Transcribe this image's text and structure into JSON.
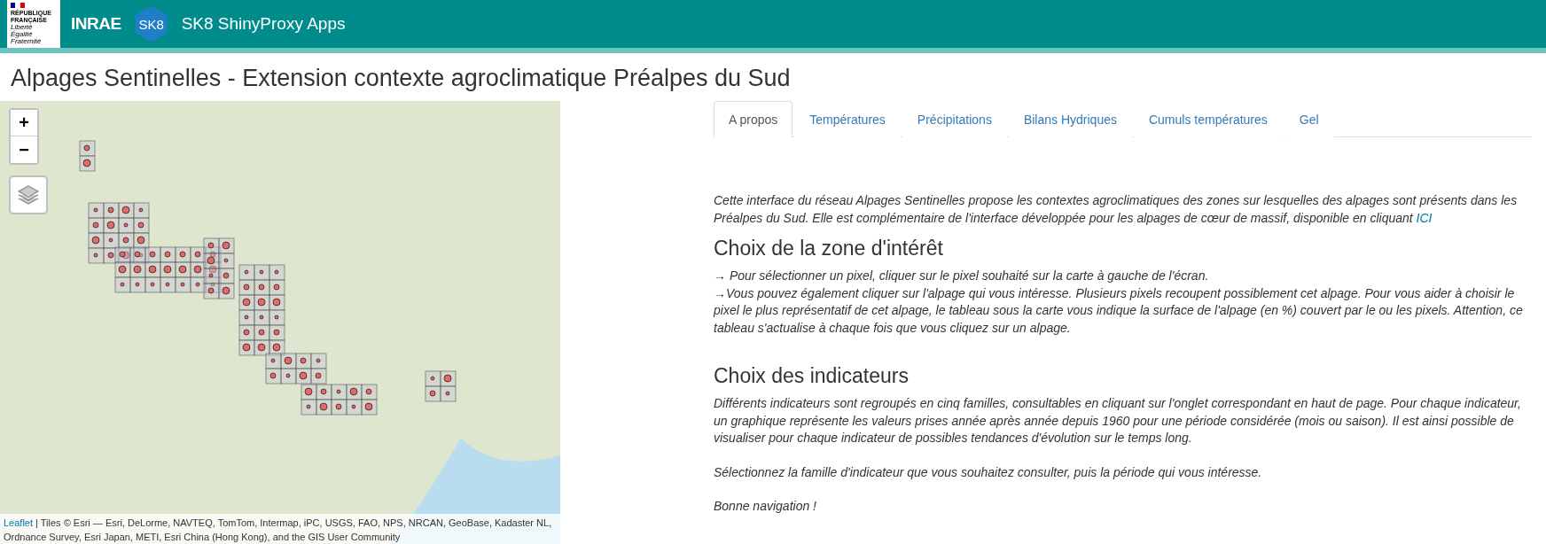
{
  "header": {
    "gov_logo": {
      "name": "RÉPUBLIQUE FRANÇAISE",
      "motto": "Liberté Égalité Fraternité"
    },
    "org_logo": "INRAE",
    "badge": "SK8",
    "title": "SK8 ShinyProxy Apps"
  },
  "page_title": "Alpages Sentinelles - Extension contexte agroclimatique Préalpes du Sud",
  "map": {
    "zoom_in": "+",
    "zoom_out": "−",
    "attribution": {
      "link": "Leaflet",
      "text": " | Tiles © Esri — Esri, DeLorme, NAVTEQ, TomTom, Intermap, iPC, USGS, FAO, NPS, NRCAN, GeoBase, Kadaster NL, Ordnance Survey, Esri Japan, METI, Esri China (Hong Kong), and the GIS User Community"
    }
  },
  "tabs": [
    {
      "label": "A propos",
      "selected": true
    },
    {
      "label": "Températures",
      "selected": false
    },
    {
      "label": "Précipitations",
      "selected": false
    },
    {
      "label": "Bilans Hydriques",
      "selected": false
    },
    {
      "label": "Cumuls températures",
      "selected": false
    },
    {
      "label": "Gel",
      "selected": false
    }
  ],
  "content": [
    {
      "kind": "paragraph",
      "text": "Cette interface du réseau Alpages Sentinelles propose les contextes agroclimatiques des zones sur lesquelles des alpages sont présents dans les Préalpes du Sud. Elle est complémentaire de l'interface développée pour les alpages de cœur de massif, disponible en cliquant ",
      "link": "ICI"
    },
    {
      "kind": "heading",
      "text": "Choix de la zone d'intérêt"
    },
    {
      "kind": "paragraph",
      "text": "→ Pour sélectionner un pixel, cliquer sur le pixel souhaité sur la carte à gauche de l'écran."
    },
    {
      "kind": "paragraph",
      "text": "→Vous pouvez également cliquer sur l'alpage qui vous intéresse. Plusieurs pixels recoupent possiblement cet alpage. Pour vous aider à choisir le pixel le plus représentatif de cet alpage, le tableau sous la carte vous indique la surface de l'alpage (en %) couvert par le ou les pixels. Attention, ce tableau s'actualise à chaque fois que vous cliquez sur un alpage."
    },
    {
      "kind": "heading",
      "text": "Choix des indicateurs"
    },
    {
      "kind": "paragraph",
      "text": "Différents indicateurs sont regroupés en cinq familles, consultables en cliquant sur l'onglet correspondant en haut de page. Pour chaque indicateur, un graphique représente les valeurs prises année après année depuis 1960 pour une période considérée (mois ou saison). Il est ainsi possible de visualiser pour chaque indicateur de possibles tendances d'évolution sur le temps long."
    },
    {
      "kind": "paragraph",
      "text": "Sélectionnez la famille d'indicateur que vous souhaitez consulter, puis la période qui vous intéresse."
    },
    {
      "kind": "paragraph",
      "text": "Bonne navigation !"
    }
  ]
}
